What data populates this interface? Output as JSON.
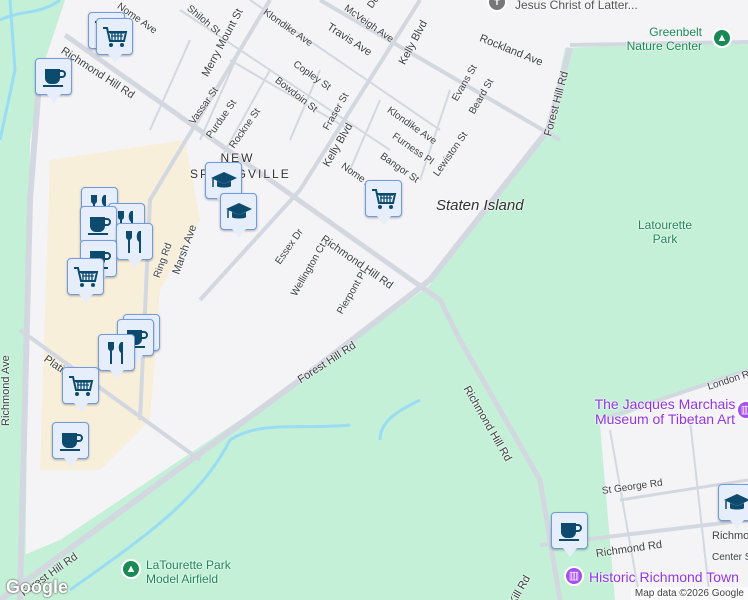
{
  "labels": [
    "Richmond Hill Rd",
    "Merry Mount St",
    "Shiloh St",
    "Klondike Ave",
    "Travis Ave",
    "McVeigh Ave",
    "Kelly Blvd",
    "Rockland Ave",
    "Copley St",
    "Bowdoin St",
    "Vassar St",
    "Purdue St",
    "Rockne St",
    "Fraser St",
    "Kelly Blvd",
    "Evans St",
    "Beard St",
    "Klondike Ave",
    "Furness Pl",
    "Bangor St",
    "Lewiston St",
    "Nome Ave",
    "Forest Hill Rd",
    "Staten Island",
    "Latourette Park",
    "Greenbelt Nature Center",
    "Jesus Christ of Latter...",
    "NEW SPRINGVILLE",
    "Richmond Hill Rd",
    "Essex Dr",
    "Wellington Ct",
    "Pierpont Pl",
    "Marsh Ave",
    "Ring Rd",
    "Richmond Ave",
    "Platinum Ave",
    "Forest Hill Rd",
    "Forest Hill Rd",
    "Richmond Hill Rd",
    "London Rd",
    "The Jacques Marchais Museum of Tibetan Art",
    "St George Rd",
    "Richmond Rd",
    "Richmond Rd",
    "Center St",
    "Historic Richmond Town",
    "Kill Rd",
    "LaTourette Park Model Airfield",
    "Nome Ave",
    "Denker Pl"
  ],
  "markers": [
    "cart",
    "cart",
    "coffee",
    "school",
    "school",
    "restaurant",
    "restaurant",
    "coffee",
    "restaurant",
    "cart",
    "cart",
    "coffee",
    "coffee",
    "restaurant",
    "cart",
    "coffee",
    "coffee",
    "school"
  ],
  "colors": {
    "park": "#c3f0d6",
    "urban": "#f4f3f5",
    "mall": "#f8efda",
    "water": "#9bdcf5",
    "road": "#d3d8e0",
    "pin_bg": "#e6eefc",
    "pin_icon": "#0c4a6e",
    "poi": "#9334e6",
    "park_text": "#188a55"
  },
  "attribution": "Map data ©2026 Google",
  "logo": "Google"
}
